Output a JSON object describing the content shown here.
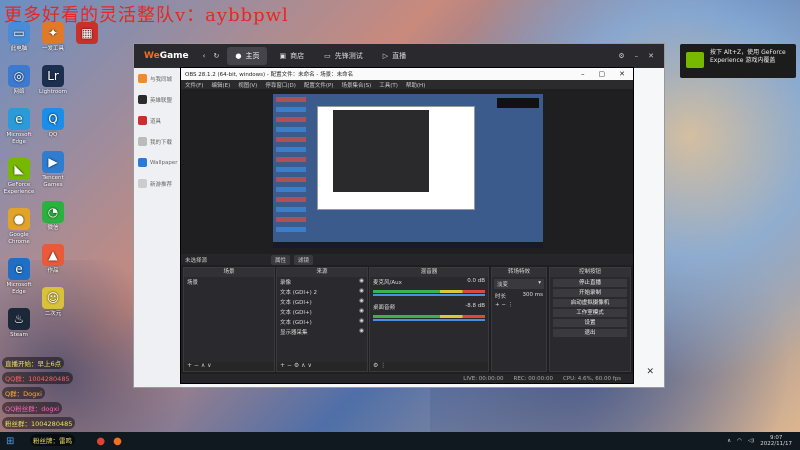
{
  "watermark": "更多好看的灵活整队v：aybbpwl",
  "desktop_icons": [
    {
      "label": "此电脑"
    },
    {
      "label": "网络"
    },
    {
      "label": "Microsoft Edge"
    },
    {
      "label": "GeForce Experience"
    },
    {
      "label": "Google Chrome"
    },
    {
      "label": "Microsoft Edge"
    },
    {
      "label": "Steam"
    }
  ],
  "desktop_icons2": [
    {
      "label": "一发工具"
    },
    {
      "label": "Lightroom"
    },
    {
      "label": "QQ"
    },
    {
      "label": "Tencent Games"
    },
    {
      "label": "微信"
    },
    {
      "label": "作品"
    },
    {
      "label": "二次元"
    }
  ],
  "overlay": [
    {
      "text": "直播开始：早上6点"
    },
    {
      "text": "QQ群：1004280485"
    },
    {
      "text": "Q群：Dogxi"
    },
    {
      "text": "QQ粉丝群：dogxi"
    },
    {
      "text": "粉丝群：1004280485"
    },
    {
      "text": "粉丝牌：雷鸣"
    }
  ],
  "geforce": {
    "text": "按下 Alt+Z，使用 GeForce Experience 游戏内覆盖"
  },
  "wegame": {
    "logo_we": "We",
    "logo_game": "Game",
    "tabs": [
      {
        "label": "主页"
      },
      {
        "label": "商店"
      },
      {
        "label": "先锋测试"
      },
      {
        "label": "直播"
      }
    ],
    "sidebar": [
      {
        "label": "与我同城"
      },
      {
        "label": "英雄联盟"
      },
      {
        "label": "道具"
      },
      {
        "label": "我的下载"
      },
      {
        "label": "Wallpaper"
      },
      {
        "label": "新游推荐"
      }
    ]
  },
  "obs": {
    "title": "OBS 28.1.2 (64-bit, windows) - 配置文件：未命名 - 场景：未命名",
    "menu": [
      "文件(F)",
      "编辑(E)",
      "视图(V)",
      "停靠窗口(D)",
      "配置文件(P)",
      "场景集合(S)",
      "工具(T)",
      "帮助(H)"
    ],
    "source_label": "未选择源",
    "props_btn": "属性",
    "filters_btn": "滤镜",
    "scenes": {
      "title": "场景",
      "items": [
        "场景"
      ]
    },
    "sources": {
      "title": "来源",
      "items": [
        "录像",
        "文本 (GDI+) 2",
        "文本 (GDI+)",
        "文本 (GDI+)",
        "文本 (GDI+)",
        "显示器采集"
      ]
    },
    "mixer": {
      "title": "混音器",
      "ch1": {
        "name": "麦克风/Aux",
        "db": "0.0 dB"
      },
      "ch2": {
        "name": "桌面音频",
        "db": "-8.8 dB"
      }
    },
    "transitions": {
      "title": "转场特效",
      "type": "淡变",
      "duration_label": "时长",
      "duration": "300 ms"
    },
    "controls": {
      "title": "控制按钮",
      "buttons": [
        "停止直播",
        "开始录制",
        "启动虚拟摄像机",
        "工作室模式",
        "设置",
        "退出"
      ]
    },
    "status": {
      "live": "LIVE: 00:00:00",
      "rec": "REC: 00:00:00",
      "cpu": "CPU: 4.6%, 60.00 fps"
    }
  },
  "taskbar": {
    "time": "9:07",
    "date": "2022/11/17"
  }
}
